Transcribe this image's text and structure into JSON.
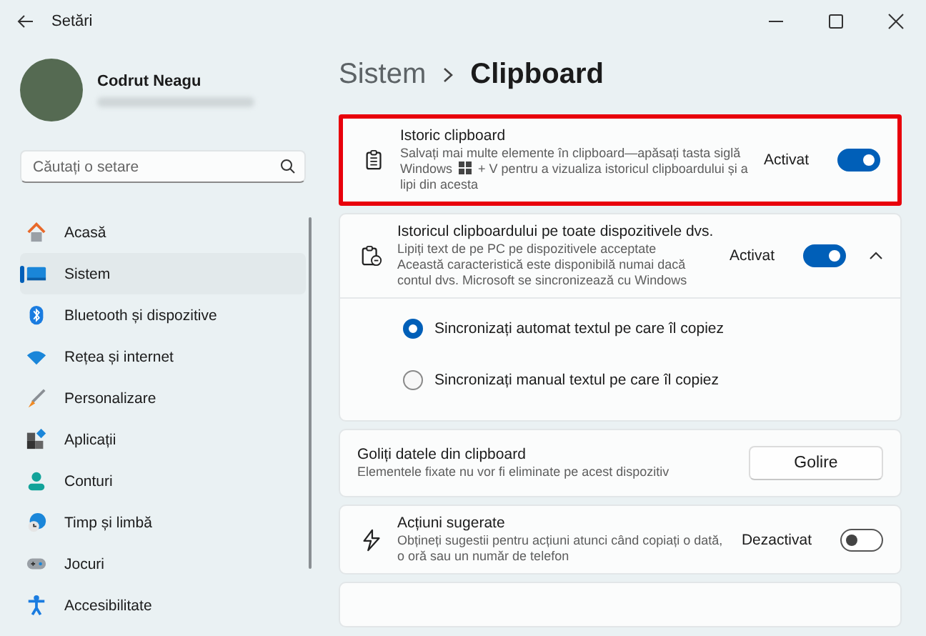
{
  "window": {
    "title": "Setări"
  },
  "profile": {
    "name": "Codrut Neagu"
  },
  "search": {
    "placeholder": "Căutați o setare"
  },
  "sidebar": {
    "items": [
      {
        "label": "Acasă",
        "selected": false
      },
      {
        "label": "Sistem",
        "selected": true
      },
      {
        "label": "Bluetooth și dispozitive",
        "selected": false
      },
      {
        "label": "Rețea și internet",
        "selected": false
      },
      {
        "label": "Personalizare",
        "selected": false
      },
      {
        "label": "Aplicații",
        "selected": false
      },
      {
        "label": "Conturi",
        "selected": false
      },
      {
        "label": "Timp și limbă",
        "selected": false
      },
      {
        "label": "Jocuri",
        "selected": false
      },
      {
        "label": "Accesibilitate",
        "selected": false
      }
    ]
  },
  "breadcrumb": [
    "Sistem",
    "Clipboard"
  ],
  "settings": [
    {
      "kind": "toggle",
      "title": "Istoric clipboard",
      "description_parts": [
        "Salvați mai multe elemente în clipboard—apăsați tasta siglă Windows",
        "+ V pentru a vizualiza istoricul clipboardului și a lipi din acesta"
      ],
      "state_label": "Activat",
      "on": true,
      "highlighted": true
    },
    {
      "kind": "expander",
      "title": "Istoricul clipboardului pe toate dispozitivele dvs.",
      "description_parts": [
        "Lipiți text de pe PC pe dispozitivele acceptate"
      ],
      "note": "Această caracteristică este disponibilă numai dacă contul dvs. Microsoft se sincronizează cu Windows",
      "state_label": "Activat",
      "on": true,
      "expanded": true,
      "highlighted": false,
      "options": [
        {
          "label": "Sincronizați automat textul pe care îl copiez",
          "selected": true
        },
        {
          "label": "Sincronizați manual textul pe care îl copiez",
          "selected": false
        }
      ]
    },
    {
      "kind": "button",
      "title": "Goliți datele din clipboard",
      "description_parts": [
        "Elementele fixate nu vor fi eliminate pe acest dispozitiv"
      ],
      "button": "Golire",
      "highlighted": false
    },
    {
      "kind": "toggle",
      "title": "Acțiuni sugerate",
      "description_parts": [
        "Obțineți sugestii pentru acțiuni atunci când copiați o dată, o oră sau un număr de telefon"
      ],
      "state_label": "Dezactivat",
      "on": false,
      "highlighted": false
    }
  ]
}
